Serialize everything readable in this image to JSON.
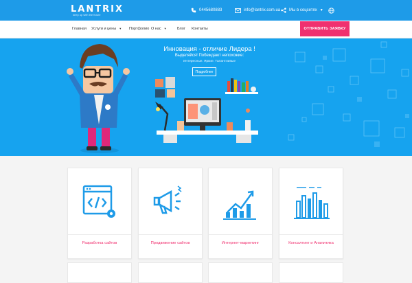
{
  "brand": {
    "logo": "LANTRIX",
    "tagline": "keep up with the future"
  },
  "topbar": {
    "phone": "0445680883",
    "email": "info@lantrix.com.ua",
    "social": "Мы в соцсетях"
  },
  "nav": {
    "items": [
      {
        "label": "Главная",
        "dropdown": false
      },
      {
        "label": "Услуги и цены",
        "dropdown": true
      },
      {
        "label": "Портфолио",
        "dropdown": false
      },
      {
        "label": "О нас",
        "dropdown": true
      },
      {
        "label": "Блог",
        "dropdown": false
      },
      {
        "label": "Контакты",
        "dropdown": false
      }
    ],
    "cta_label": "ОТПРАВИТЬ ЗАЯВКУ"
  },
  "hero": {
    "title": "Инновация - отличие Лидера !",
    "subtitle": "Выделяйся! Побеждают непохожие:",
    "tagline": "Интересные. Яркие. Талантливые",
    "button": "Подробнее"
  },
  "services": [
    {
      "label": "Разработка сайтов",
      "icon": "code-window-icon"
    },
    {
      "label": "Продвижение сайтов",
      "icon": "megaphone-icon"
    },
    {
      "label": "Интернет-маркетинг",
      "icon": "growth-chart-icon"
    },
    {
      "label": "Консалтинг и Аналитика",
      "icon": "bar-chart-icon"
    }
  ],
  "colors": {
    "primary": "#1e9be8",
    "hero": "#16a3ef",
    "accent": "#f0306f"
  }
}
